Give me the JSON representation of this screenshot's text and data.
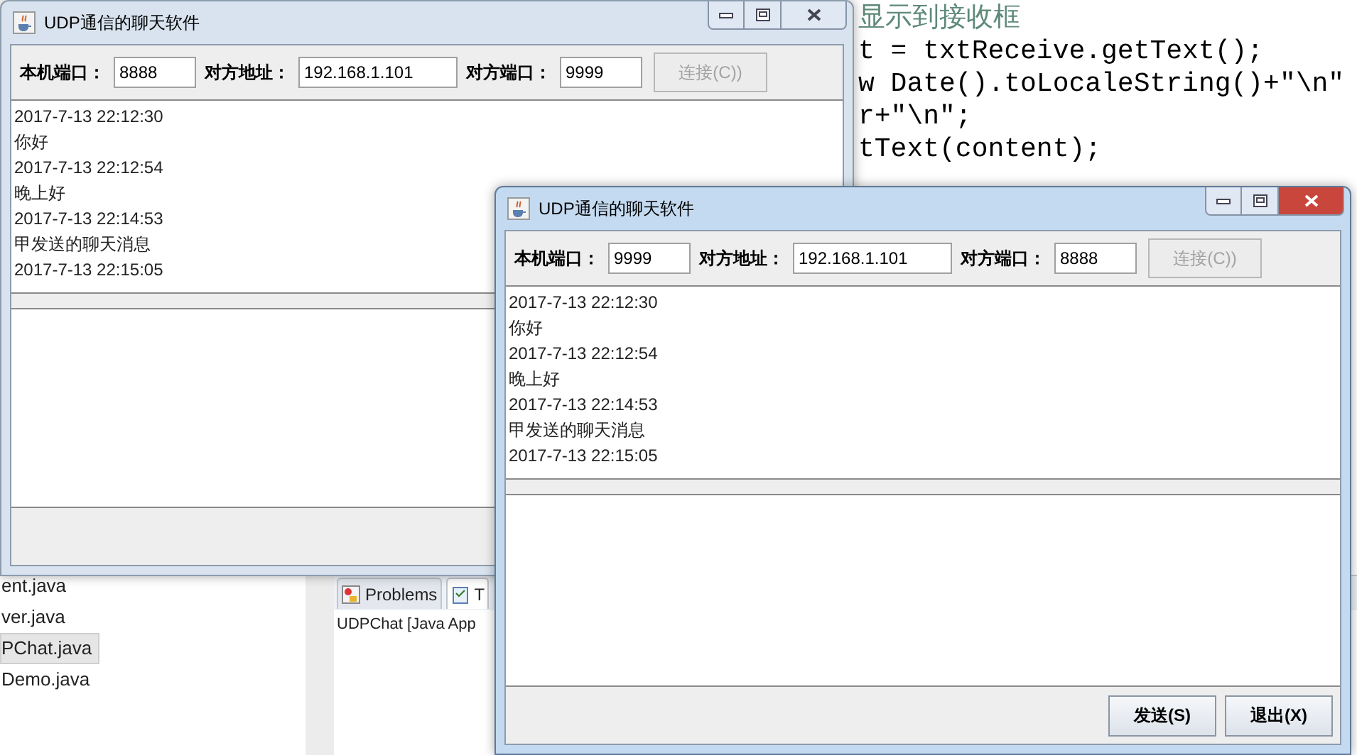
{
  "ide": {
    "editor_lines": [
      {
        "kind": "comment",
        "text": "显示到接收框"
      },
      {
        "kind": "code",
        "text": "t = txtReceive.getText();"
      },
      {
        "kind": "code",
        "text": "w Date().toLocaleString()+\"\\n\""
      },
      {
        "kind": "code",
        "text": "r+\"\\n\";"
      },
      {
        "kind": "code",
        "text": "tText(content);"
      }
    ],
    "package_items": [
      {
        "label": "ent.java",
        "selected": false
      },
      {
        "label": "ver.java",
        "selected": false
      },
      {
        "label": "PChat.java",
        "selected": true
      },
      {
        "label": "Demo.java",
        "selected": false
      }
    ],
    "console_tabs": [
      {
        "label": "Problems",
        "selected": false
      },
      {
        "label": "T",
        "selected": true
      }
    ],
    "console_line": "UDPChat [Java App"
  },
  "windows": [
    {
      "title": "UDP通信的聊天软件",
      "active": false,
      "local_port_label": "本机端口：",
      "local_port": "8888",
      "remote_address_label": "对方地址：",
      "remote_address": "192.168.1.101",
      "remote_port_label": "对方端口：",
      "remote_port": "9999",
      "connect_button": {
        "label": "连接(C))",
        "disabled": true
      },
      "messages": [
        "2017-7-13 22:12:30",
        "你好",
        "2017-7-13 22:12:54",
        "晚上好",
        "2017-7-13 22:14:53",
        "甲发送的聊天消息",
        "2017-7-13 22:15:05"
      ]
    },
    {
      "title": "UDP通信的聊天软件",
      "active": true,
      "local_port_label": "本机端口：",
      "local_port": "9999",
      "remote_address_label": "对方地址：",
      "remote_address": "192.168.1.101",
      "remote_port_label": "对方端口：",
      "remote_port": "8888",
      "connect_button": {
        "label": "连接(C))",
        "disabled": true
      },
      "messages": [
        "2017-7-13 22:12:30",
        "你好",
        "2017-7-13 22:12:54",
        "晚上好",
        "2017-7-13 22:14:53",
        "甲发送的聊天消息",
        "2017-7-13 22:15:05"
      ],
      "buttons": [
        "发送(S)",
        "退出(X)"
      ]
    }
  ]
}
